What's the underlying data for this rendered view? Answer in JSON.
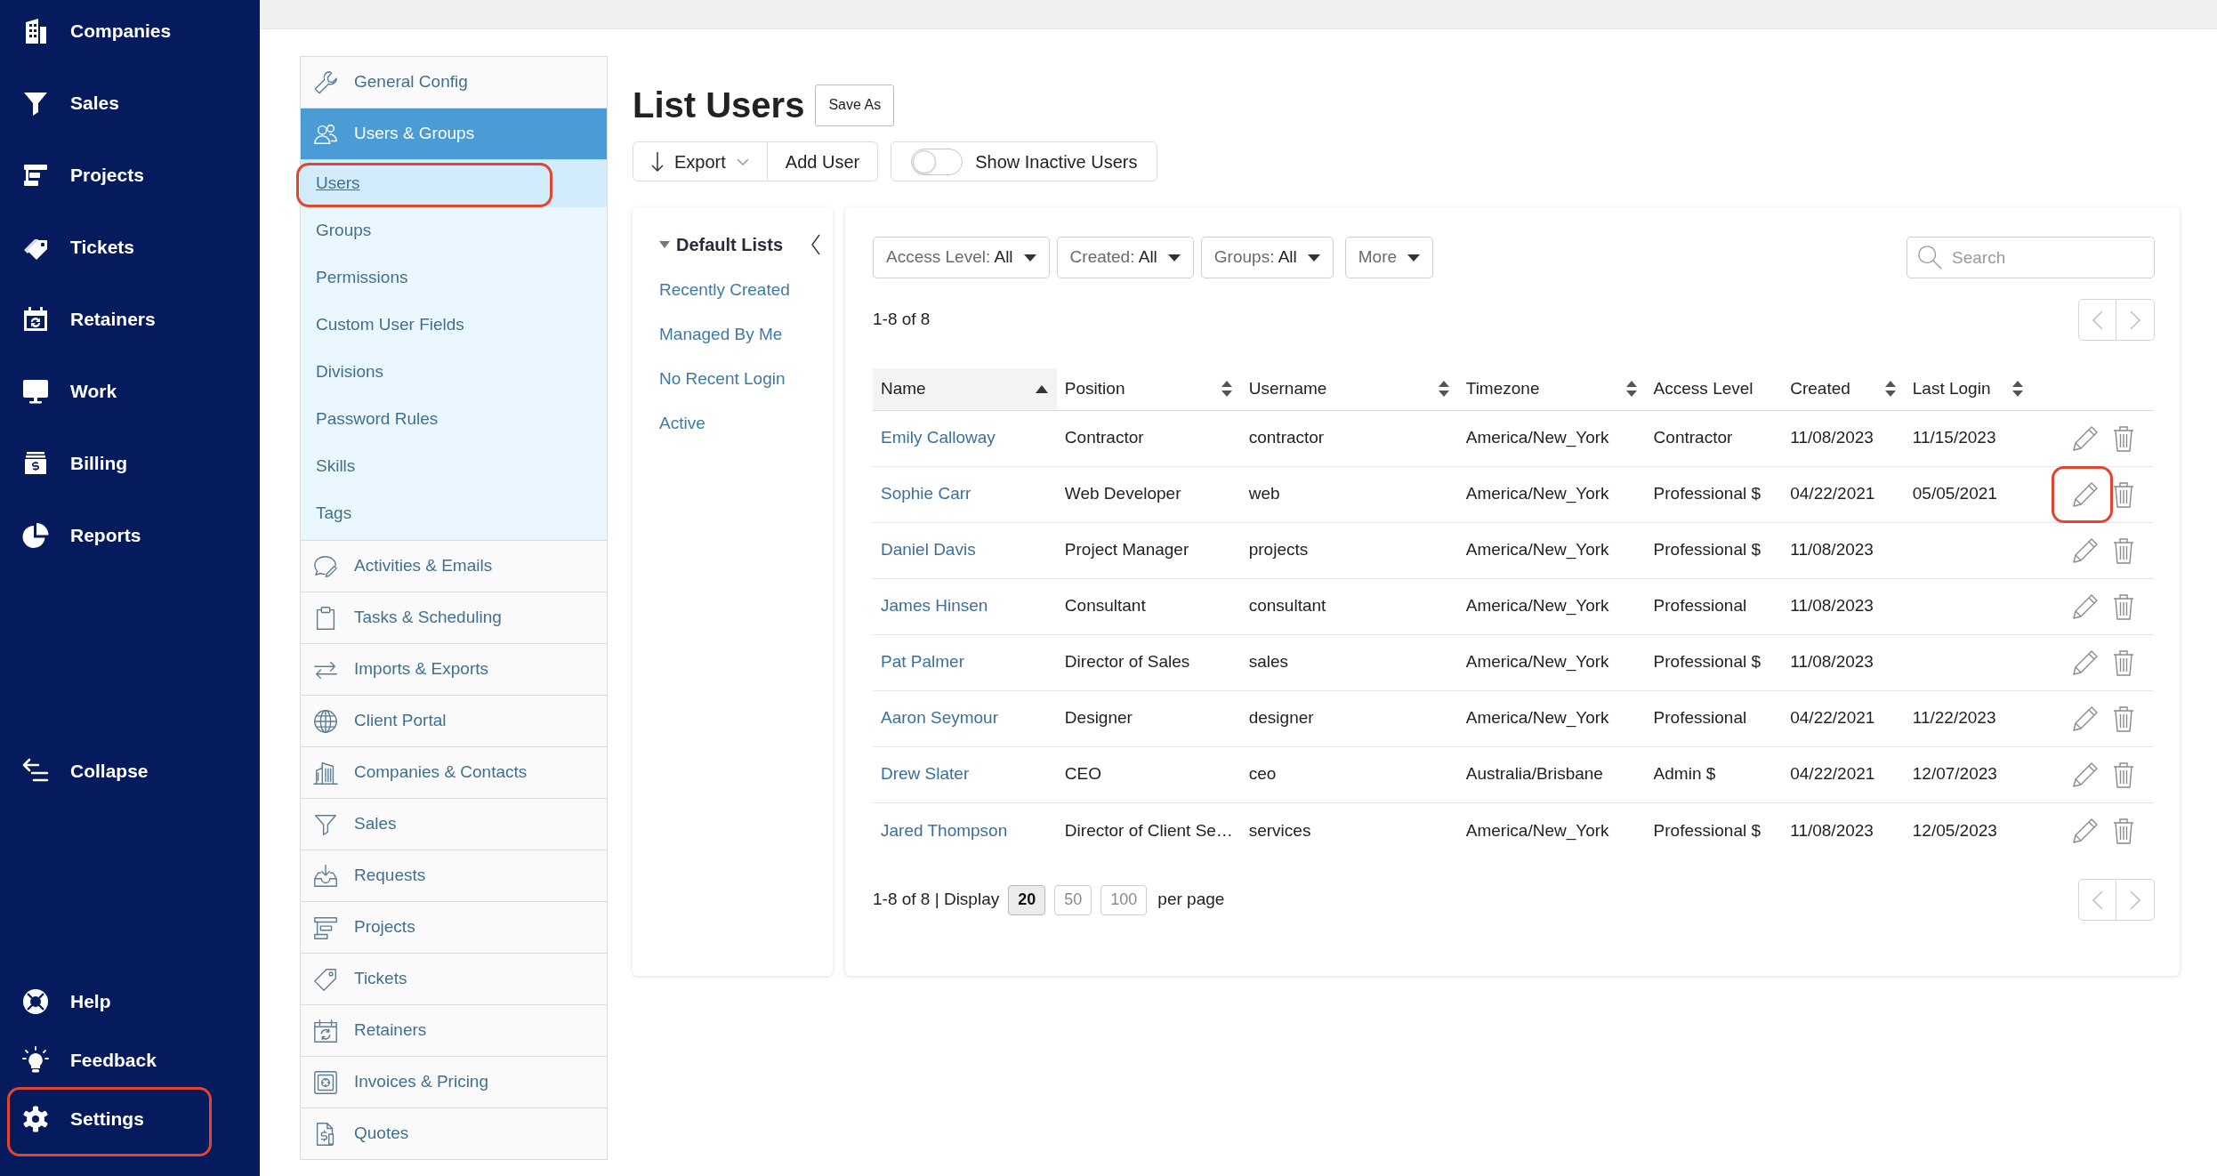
{
  "nav": {
    "items": [
      {
        "label": "Companies",
        "highlighted": false
      },
      {
        "label": "Sales",
        "highlighted": false
      },
      {
        "label": "Projects",
        "highlighted": false
      },
      {
        "label": "Tickets",
        "highlighted": false
      },
      {
        "label": "Retainers",
        "highlighted": false
      },
      {
        "label": "Work",
        "highlighted": false
      },
      {
        "label": "Billing",
        "highlighted": false
      },
      {
        "label": "Reports",
        "highlighted": false
      }
    ],
    "collapse": "Collapse",
    "bottom_items": [
      {
        "label": "Help",
        "highlighted": false
      },
      {
        "label": "Feedback",
        "highlighted": false
      },
      {
        "label": "Settings",
        "highlighted": true
      }
    ]
  },
  "settings_menu": [
    {
      "label": "General Config",
      "selected": false
    },
    {
      "label": "Users & Groups",
      "selected": true,
      "expanded": true,
      "children": [
        {
          "label": "Users",
          "selected": true,
          "highlighted": true
        },
        {
          "label": "Groups",
          "selected": false,
          "highlighted": false
        },
        {
          "label": "Permissions",
          "selected": false,
          "highlighted": false
        },
        {
          "label": "Custom User Fields",
          "selected": false,
          "highlighted": false
        },
        {
          "label": "Divisions",
          "selected": false,
          "highlighted": false
        },
        {
          "label": "Password Rules",
          "selected": false,
          "highlighted": false
        },
        {
          "label": "Skills",
          "selected": false,
          "highlighted": false
        },
        {
          "label": "Tags",
          "selected": false,
          "highlighted": false
        }
      ]
    },
    {
      "label": "Activities & Emails",
      "selected": false
    },
    {
      "label": "Tasks & Scheduling",
      "selected": false
    },
    {
      "label": "Imports & Exports",
      "selected": false
    },
    {
      "label": "Client Portal",
      "selected": false
    },
    {
      "label": "Companies & Contacts",
      "selected": false
    },
    {
      "label": "Sales",
      "selected": false
    },
    {
      "label": "Requests",
      "selected": false
    },
    {
      "label": "Projects",
      "selected": false
    },
    {
      "label": "Tickets",
      "selected": false
    },
    {
      "label": "Retainers",
      "selected": false
    },
    {
      "label": "Invoices & Pricing",
      "selected": false
    },
    {
      "label": "Quotes",
      "selected": false
    }
  ],
  "page": {
    "title": "List Users",
    "save_button": "Save As"
  },
  "toolbar": {
    "buttons": [
      {
        "label": "Export",
        "kind": "dropdown"
      },
      {
        "label": "Add User",
        "kind": "plain"
      }
    ],
    "toggle": {
      "label": "Show Inactive Users",
      "on": false
    }
  },
  "default_lists": {
    "title": "Default Lists",
    "expanded": true,
    "items": [
      "Recently Created",
      "Managed By Me",
      "No Recent Login",
      "Active"
    ]
  },
  "filters": [
    {
      "label": "Access Level:",
      "value": "All"
    },
    {
      "label": "Created:",
      "value": "All"
    },
    {
      "label": "Groups:",
      "value": "All"
    },
    {
      "label": "More"
    }
  ],
  "search": {
    "placeholder": "Search"
  },
  "summary": "1-8 of 8",
  "top_pager": {
    "previous_disabled": true,
    "next_disabled": true
  },
  "table": {
    "columns": [
      {
        "label": "Name",
        "sortable": true,
        "sorted": true
      },
      {
        "label": "Position",
        "sortable": true,
        "sorted": false
      },
      {
        "label": "Username",
        "sortable": true,
        "sorted": false
      },
      {
        "label": "Timezone",
        "sortable": true,
        "sorted": false
      },
      {
        "label": "Access Level",
        "sortable": false,
        "sorted": false
      },
      {
        "label": "Created",
        "sortable": true,
        "sorted": false
      },
      {
        "label": "Last Login",
        "sortable": true,
        "sorted": false
      }
    ],
    "rows": [
      {
        "name": "Emily Calloway",
        "position": "Contractor",
        "username": "contractor",
        "timezone": "America/New_York",
        "access_level": "Contractor",
        "created": "11/08/2023",
        "last_login": "11/15/2023",
        "edit_highlighted": false
      },
      {
        "name": "Sophie Carr",
        "position": "Web Developer",
        "username": "web",
        "timezone": "America/New_York",
        "access_level": "Professional $",
        "created": "04/22/2021",
        "last_login": "05/05/2021",
        "edit_highlighted": true
      },
      {
        "name": "Daniel Davis",
        "position": "Project Manager",
        "username": "projects",
        "timezone": "America/New_York",
        "access_level": "Professional $",
        "created": "11/08/2023",
        "edit_highlighted": false
      },
      {
        "name": "James Hinsen",
        "position": "Consultant",
        "username": "consultant",
        "timezone": "America/New_York",
        "access_level": "Professional",
        "created": "11/08/2023",
        "edit_highlighted": false
      },
      {
        "name": "Pat Palmer",
        "position": "Director of Sales",
        "username": "sales",
        "timezone": "America/New_York",
        "access_level": "Professional $",
        "created": "11/08/2023",
        "edit_highlighted": false
      },
      {
        "name": "Aaron Seymour",
        "position": "Designer",
        "username": "designer",
        "timezone": "America/New_York",
        "access_level": "Professional",
        "created": "04/22/2021",
        "last_login": "11/22/2023",
        "edit_highlighted": false
      },
      {
        "name": "Drew Slater",
        "position": "CEO",
        "username": "ceo",
        "timezone": "Australia/Brisbane",
        "access_level": "Admin $",
        "created": "04/22/2021",
        "last_login": "12/07/2023",
        "edit_highlighted": false
      },
      {
        "name": "Jared Thompson",
        "position": "Director of Client Se…",
        "username": "services",
        "timezone": "America/New_York",
        "access_level": "Professional $",
        "created": "11/08/2023",
        "last_login": "12/05/2023",
        "edit_highlighted": false
      }
    ]
  },
  "footer": {
    "summary": "1-8 of 8 | Display",
    "page_sizes": [
      {
        "label": "20",
        "selected": true
      },
      {
        "label": "50",
        "selected": false
      },
      {
        "label": "100",
        "selected": false
      }
    ],
    "suffix": "per page",
    "pager": {
      "previous_disabled": true,
      "next_disabled": true
    }
  }
}
